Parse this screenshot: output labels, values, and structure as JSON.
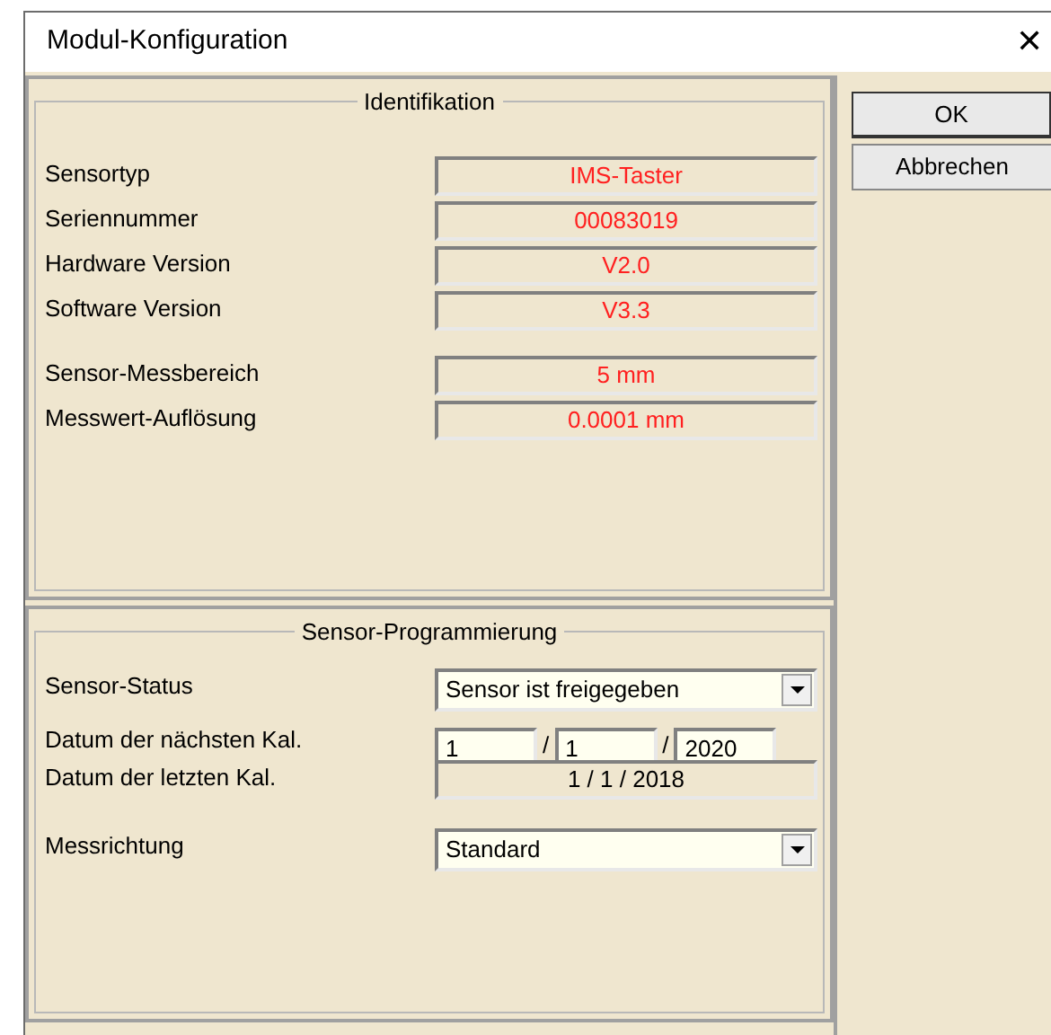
{
  "window": {
    "title": "Modul-Konfiguration",
    "close": "✕"
  },
  "identification": {
    "title": "Identifikation",
    "groups": [
      [
        {
          "label": "Sensortyp",
          "value": "IMS-Taster"
        },
        {
          "label": "Seriennummer",
          "value": "00083019"
        },
        {
          "label": "Hardware Version",
          "value": "V2.0"
        },
        {
          "label": "Software Version",
          "value": "V3.3"
        }
      ],
      [
        {
          "label": "Sensor-Messbereich",
          "value": "5 mm"
        },
        {
          "label": "Messwert-Auflösung",
          "value": "0.0001 mm"
        }
      ]
    ]
  },
  "programming": {
    "title": "Sensor-Programmierung",
    "status": {
      "label": "Sensor-Status",
      "value": "Sensor ist freigegeben"
    },
    "next_cal": {
      "label": "Datum der nächsten Kal.",
      "day": "1",
      "sep1": "/",
      "month": "1",
      "sep2": "/",
      "year": "2020"
    },
    "last_cal": {
      "label": "Datum der letzten Kal.",
      "value": "1 / 1 / 2018"
    },
    "direction": {
      "label": "Messrichtung",
      "value": "Standard"
    }
  },
  "buttons": [
    "OK",
    "Abbrechen"
  ]
}
